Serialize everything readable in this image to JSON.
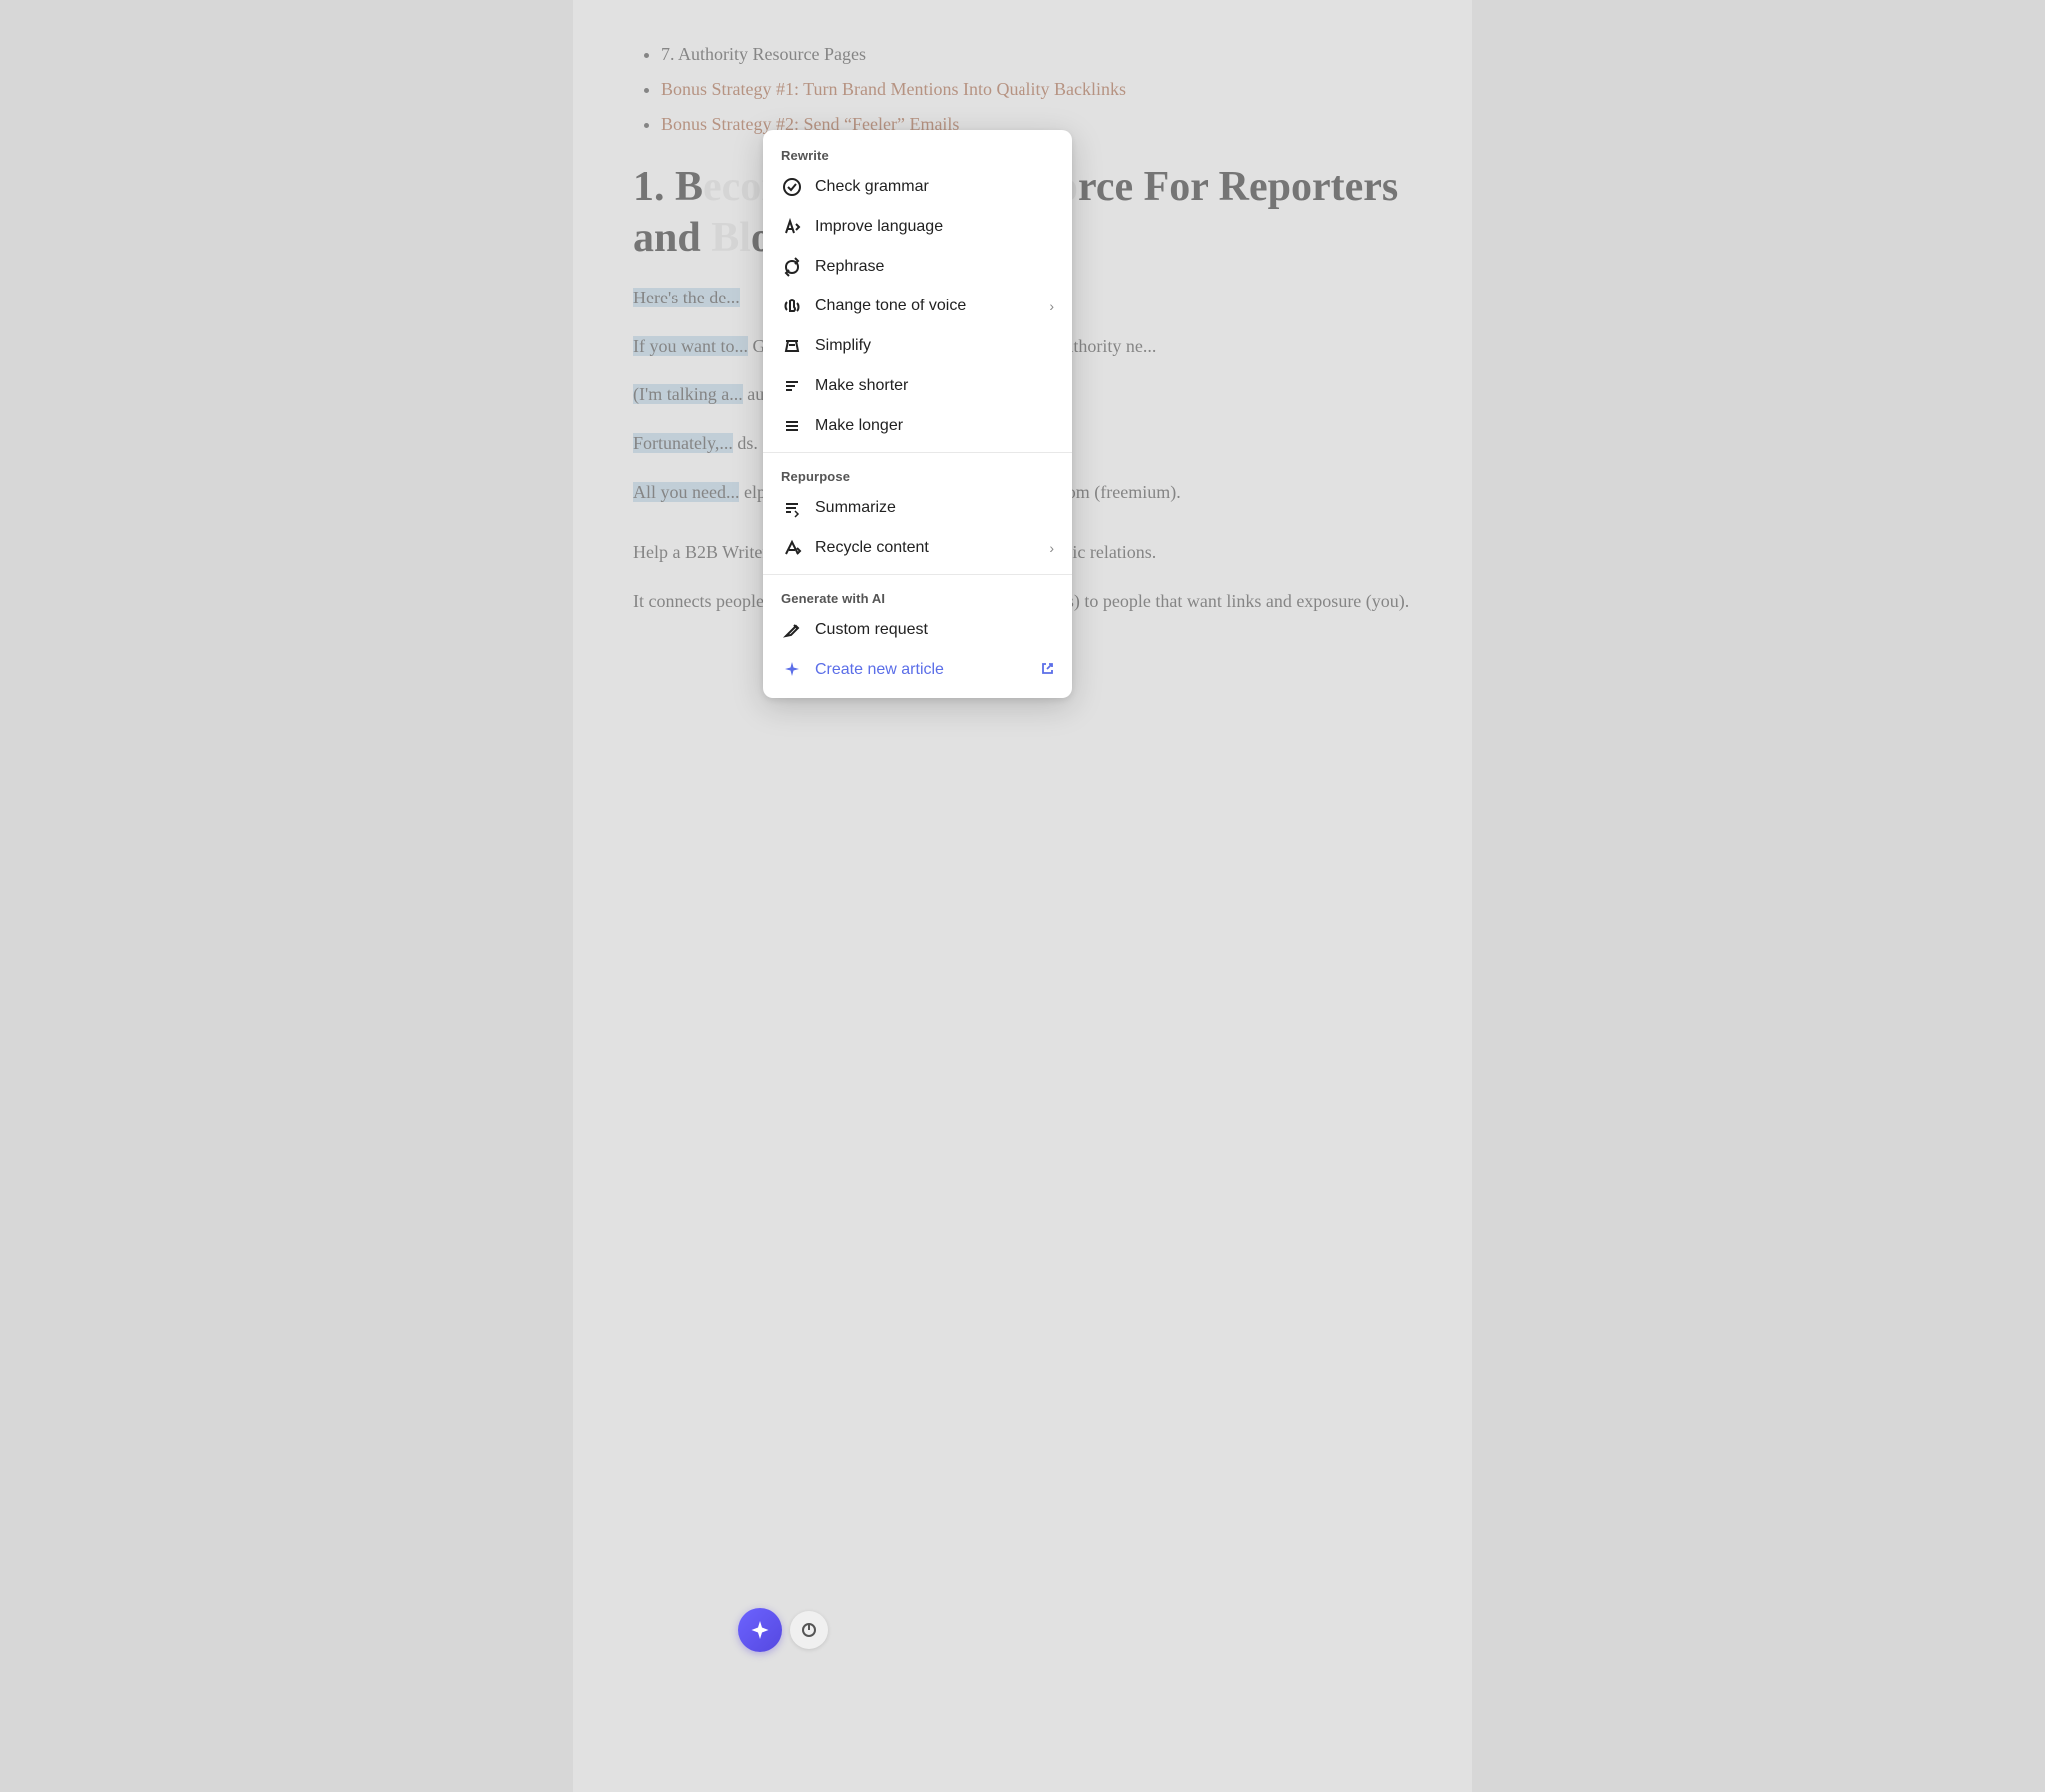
{
  "page": {
    "bullets": [
      {
        "text": "7. Authority Resource Pages",
        "link": false
      },
      {
        "text": "Bonus Strategy #1: Turn Brand Mentions Into Quality Backlinks",
        "link": true
      },
      {
        "text": "Bonus Strategy #2: Send “Feeler” Emails",
        "link": true
      }
    ],
    "heading": "1. B... rce For Reporters and loggers",
    "heading_full": "1. Become a Resource For Reporters and Bloggers",
    "highlighted_paragraphs": [
      "Here’s the de...",
      "If you want to... Google, you need to build backlinks from authority ne...",
      "(I’m talking a... authority news sites and blogs.)",
      "Fortunately,...ds.",
      "All you need... elp a B2B Writer (100% free) and Featured.com (freemium)..."
    ],
    "bottom_paragraphs": [
      "Help a B2B Writer and Featured.com are like Tinder for public relations.",
      "It connects people that need sources (bloggers and journalists) to people that want links and exposure (you)."
    ]
  },
  "context_menu": {
    "rewrite_label": "Rewrite",
    "repurpose_label": "Repurpose",
    "generate_label": "Generate with AI",
    "items_rewrite": [
      {
        "id": "check-grammar",
        "icon": "✓◎",
        "label": "Check grammar",
        "has_sub": false
      },
      {
        "id": "improve-language",
        "icon": "◇⬆",
        "label": "Improve language",
        "has_sub": false
      },
      {
        "id": "rephrase",
        "icon": "↺↻",
        "label": "Rephrase",
        "has_sub": false
      },
      {
        "id": "change-tone",
        "icon": "🎤",
        "label": "Change tone of voice",
        "has_sub": true
      },
      {
        "id": "simplify",
        "icon": "👕",
        "label": "Simplify",
        "has_sub": false
      },
      {
        "id": "make-shorter",
        "icon": "≡-",
        "label": "Make shorter",
        "has_sub": false
      },
      {
        "id": "make-longer",
        "icon": "≡+",
        "label": "Make longer",
        "has_sub": false
      }
    ],
    "items_repurpose": [
      {
        "id": "summarize",
        "icon": "≡↺",
        "label": "Summarize",
        "has_sub": false
      },
      {
        "id": "recycle",
        "icon": "↙↗",
        "label": "Recycle content",
        "has_sub": true
      }
    ],
    "items_generate": [
      {
        "id": "custom-request",
        "icon": "✏",
        "label": "Custom request",
        "has_sub": false
      },
      {
        "id": "create-article",
        "icon": "✦",
        "label": "Create new article",
        "has_sub": false,
        "external": true
      }
    ]
  },
  "buttons": {
    "ai_button_label": "AI",
    "power_button_label": "Power"
  },
  "colors": {
    "link_color": "#a0522d",
    "highlight_bg": "#b8d4e8",
    "create_article_color": "#5b6ee8",
    "ai_button_bg": "#6c63ff"
  }
}
